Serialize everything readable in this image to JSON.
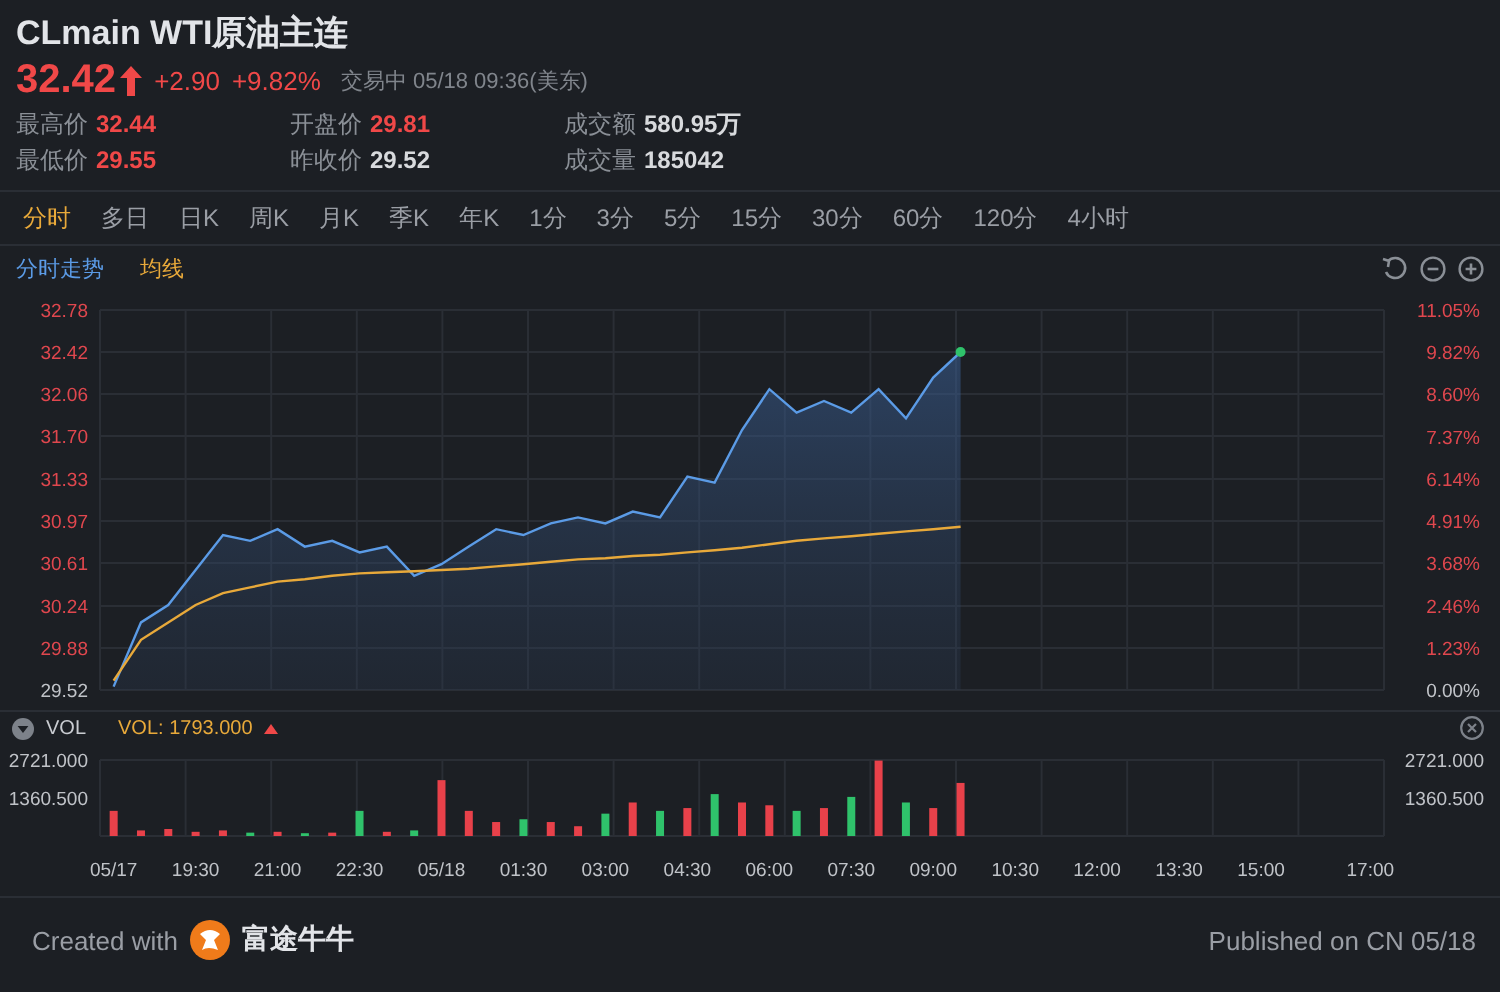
{
  "header": {
    "title": "CLmain WTI原油主连",
    "price": "32.42",
    "change": "+2.90",
    "change_pct": "+9.82%",
    "status": "交易中 05/18 09:36(美东)"
  },
  "stats": [
    {
      "label": "最高价",
      "value": "32.44",
      "kind": "up"
    },
    {
      "label": "开盘价",
      "value": "29.81",
      "kind": "up"
    },
    {
      "label": "成交额",
      "value": "580.95万",
      "kind": "plain"
    },
    {
      "label": "最低价",
      "value": "29.55",
      "kind": "up"
    },
    {
      "label": "昨收价",
      "value": "29.52",
      "kind": "plain"
    },
    {
      "label": "成交量",
      "value": "185042",
      "kind": "plain"
    }
  ],
  "tabs": [
    {
      "label": "分时",
      "selected": true
    },
    {
      "label": "多日",
      "selected": false
    },
    {
      "label": "日K",
      "selected": false
    },
    {
      "label": "周K",
      "selected": false
    },
    {
      "label": "月K",
      "selected": false
    },
    {
      "label": "季K",
      "selected": false
    },
    {
      "label": "年K",
      "selected": false
    },
    {
      "label": "1分",
      "selected": false
    },
    {
      "label": "3分",
      "selected": false
    },
    {
      "label": "5分",
      "selected": false
    },
    {
      "label": "15分",
      "selected": false
    },
    {
      "label": "30分",
      "selected": false
    },
    {
      "label": "60分",
      "selected": false
    },
    {
      "label": "120分",
      "selected": false
    },
    {
      "label": "4小时",
      "selected": false
    }
  ],
  "price_chart": {
    "percent_labels": [
      "11.05%",
      "9.82%",
      "8.60%",
      "7.37%",
      "6.14%",
      "4.91%",
      "3.68%",
      "2.46%",
      "1.23%",
      "0.00%"
    ],
    "chart_data": {
      "type": "line",
      "grid": true,
      "categories": [
        null,
        null,
        null,
        null,
        null,
        null,
        null,
        null,
        null,
        null,
        null,
        null,
        null,
        null,
        null,
        null,
        null,
        null,
        null,
        null,
        null,
        null,
        null,
        null,
        null,
        null,
        null,
        null,
        null,
        null,
        null,
        null,
        null,
        null,
        null,
        null,
        null,
        null,
        null,
        null,
        null,
        null,
        null,
        null,
        null,
        null,
        null
      ],
      "series": [
        {
          "name": "分时走势",
          "color": "#5b9be6",
          "type": "area",
          "values": [
            29.55,
            30.1,
            30.25,
            30.55,
            30.85,
            30.8,
            30.9,
            30.75,
            30.8,
            30.7,
            30.75,
            30.5,
            30.6,
            30.75,
            30.9,
            30.85,
            30.95,
            31.0,
            30.95,
            31.05,
            31.0,
            31.35,
            31.3,
            31.75,
            32.1,
            31.9,
            32.0,
            31.9,
            32.1,
            31.85,
            32.2,
            32.42,
            null,
            null,
            null,
            null,
            null,
            null,
            null,
            null,
            null,
            null,
            null,
            null,
            null,
            null,
            null
          ]
        },
        {
          "name": "均线",
          "color": "#e8a93a",
          "type": "line",
          "values": [
            29.6,
            29.95,
            30.1,
            30.25,
            30.35,
            30.4,
            30.45,
            30.47,
            30.5,
            30.52,
            30.53,
            30.54,
            30.55,
            30.56,
            30.58,
            30.6,
            30.62,
            30.64,
            30.65,
            30.67,
            30.68,
            30.7,
            30.72,
            30.74,
            30.77,
            30.8,
            30.82,
            30.84,
            30.86,
            30.88,
            30.9,
            30.92,
            null,
            null,
            null,
            null,
            null,
            null,
            null,
            null,
            null,
            null,
            null,
            null,
            null,
            null,
            null
          ]
        }
      ],
      "ylim": [
        29.52,
        32.78
      ],
      "yticks": [
        {
          "value": 32.78,
          "label": "32.78"
        },
        {
          "value": 32.42,
          "label": "32.42"
        },
        {
          "value": 32.06,
          "label": "32.06"
        },
        {
          "value": 31.7,
          "label": "31.70"
        },
        {
          "value": 31.33,
          "label": "31.33"
        },
        {
          "value": 30.97,
          "label": "30.97"
        },
        {
          "value": 30.61,
          "label": "30.61"
        },
        {
          "value": 30.24,
          "label": "30.24"
        },
        {
          "value": 29.88,
          "label": "29.88"
        },
        {
          "value": 29.52,
          "label": "29.52"
        }
      ]
    }
  },
  "volume_chart": {
    "title": "VOL",
    "reading": "VOL: 1793.000",
    "right_labels": [
      "2721.000",
      "1360.500"
    ],
    "chart_data": {
      "type": "bar",
      "grid": true,
      "categories": [
        "05/17",
        null,
        null,
        "19:30",
        null,
        null,
        "21:00",
        null,
        null,
        "22:30",
        null,
        null,
        "05/18",
        null,
        null,
        "01:30",
        null,
        null,
        "03:00",
        null,
        null,
        "04:30",
        null,
        null,
        "06:00",
        null,
        null,
        "07:30",
        null,
        null,
        "09:00",
        null,
        null,
        "10:30",
        null,
        null,
        "12:00",
        null,
        null,
        "13:30",
        null,
        null,
        "15:00",
        null,
        null,
        null,
        "17:00"
      ],
      "values": [
        900,
        200,
        250,
        150,
        200,
        120,
        150,
        100,
        120,
        900,
        150,
        200,
        2000,
        900,
        500,
        600,
        500,
        350,
        800,
        1200,
        900,
        1000,
        1500,
        1200,
        1100,
        900,
        1000,
        1400,
        2700,
        1200,
        1000,
        1900,
        null,
        null,
        null,
        null,
        null,
        null,
        null,
        null,
        null,
        null,
        null,
        null,
        null,
        null,
        null
      ],
      "ylim": [
        0,
        2721
      ],
      "yticks": [
        {
          "value": 2721,
          "label": "2721.000"
        },
        {
          "value": 1360.5,
          "label": "1360.500"
        }
      ]
    }
  },
  "footer": {
    "created_label": "Created with",
    "brand": "富途牛牛",
    "published": "Published on CN 05/18"
  }
}
